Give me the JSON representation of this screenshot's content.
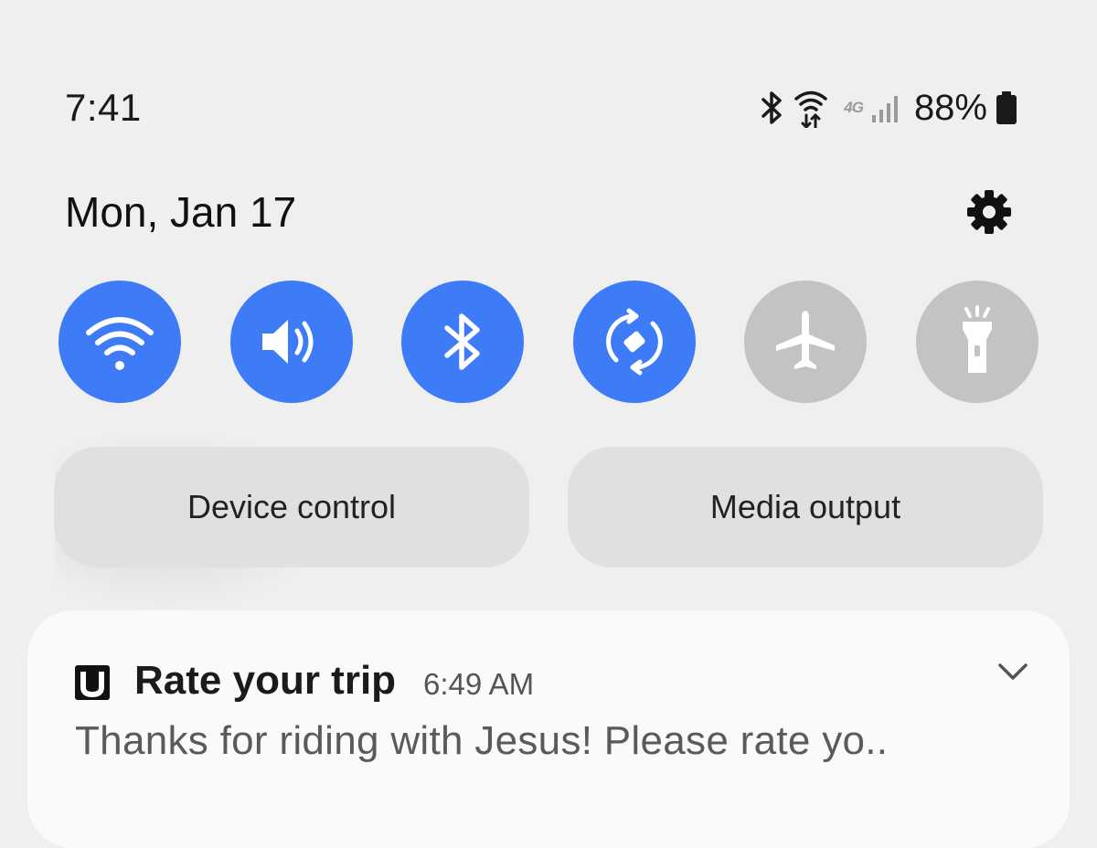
{
  "status_bar": {
    "time": "7:41",
    "network_type": "4G",
    "battery_percent": "88%",
    "icons": [
      "bluetooth-icon",
      "wifi-data-icon",
      "4g-lte-icon",
      "signal-icon",
      "battery-icon"
    ]
  },
  "header": {
    "date": "Mon, Jan 17",
    "settings_icon": "gear-icon"
  },
  "quick_toggles": [
    {
      "name": "Wi-Fi",
      "icon": "wifi-icon",
      "state": "on"
    },
    {
      "name": "Sound",
      "icon": "volume-icon",
      "state": "on"
    },
    {
      "name": "Bluetooth",
      "icon": "bluetooth-icon",
      "state": "on"
    },
    {
      "name": "Auto rotate",
      "icon": "rotate-icon",
      "state": "on"
    },
    {
      "name": "Airplane mode",
      "icon": "airplane-icon",
      "state": "off"
    },
    {
      "name": "Flashlight",
      "icon": "flashlight-icon",
      "state": "off"
    }
  ],
  "buttons": {
    "device_control": "Device control",
    "media_output": "Media output"
  },
  "notification": {
    "app_icon": "U",
    "title": "Rate your trip",
    "time": "6:49 AM",
    "body": "Thanks for riding with Jesus! Please rate yo.."
  },
  "colors": {
    "toggle_on": "#3e7bf7",
    "toggle_off": "#c3c3c3",
    "background": "#efefef",
    "pill": "#e0e0e0"
  }
}
